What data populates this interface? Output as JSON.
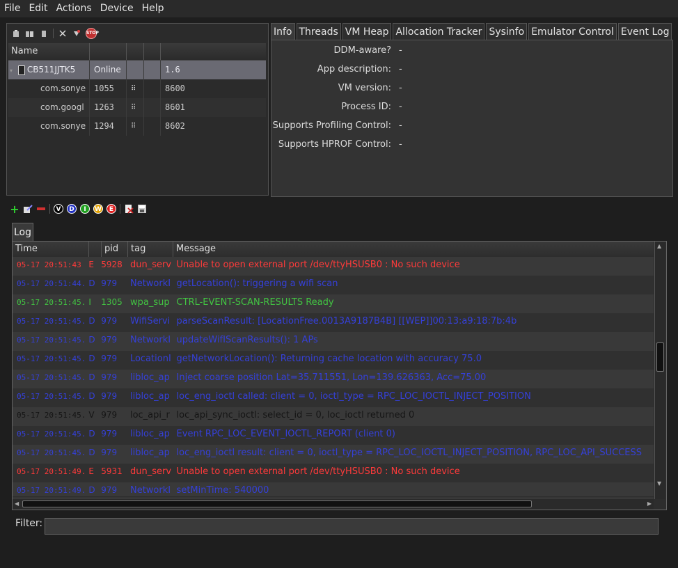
{
  "menu": [
    "File",
    "Edit",
    "Actions",
    "Device",
    "Help"
  ],
  "device_toolbar_icons": [
    "update-heap-icon",
    "update-threads-icon",
    "dump-hprof-icon",
    "cause-gc-icon",
    "start-method-profiling-icon",
    "stop-process-icon"
  ],
  "devices": {
    "columns": [
      "Name",
      "",
      "",
      "",
      ""
    ],
    "rows": [
      {
        "name": "CB511JJTK5",
        "status": "Online",
        "c3": "",
        "c4": "",
        "port": "1.6",
        "selected": true
      },
      {
        "name": "com.sonye",
        "status": "1055",
        "c3": "bug",
        "c4": "",
        "port": "8600"
      },
      {
        "name": "com.googl",
        "status": "1263",
        "c3": "bug",
        "c4": "",
        "port": "8601"
      },
      {
        "name": "com.sonye",
        "status": "1294",
        "c3": "bug",
        "c4": "",
        "port": "8602"
      }
    ]
  },
  "tabs": [
    "Info",
    "Threads",
    "VM Heap",
    "Allocation Tracker",
    "Sysinfo",
    "Emulator Control",
    "Event Log"
  ],
  "active_tab": "Info",
  "info": [
    {
      "label": "DDM-aware?",
      "value": "-"
    },
    {
      "label": "App description:",
      "value": "-"
    },
    {
      "label": "VM version:",
      "value": "-"
    },
    {
      "label": "Process ID:",
      "value": "-"
    },
    {
      "label": "Supports Profiling Control:",
      "value": "-"
    },
    {
      "label": "Supports HPROF Control:",
      "value": "-"
    }
  ],
  "log_toolbar": {
    "buttons": [
      "add-filter-icon",
      "edit-filter-icon",
      "delete-filter-icon"
    ],
    "levels": [
      {
        "letter": "V",
        "color": "#000000"
      },
      {
        "letter": "D",
        "color": "#2030c0"
      },
      {
        "letter": "I",
        "color": "#20a020"
      },
      {
        "letter": "W",
        "color": "#e0a000"
      },
      {
        "letter": "E",
        "color": "#e02020"
      }
    ],
    "extra": [
      "clear-log-icon",
      "save-log-icon"
    ]
  },
  "log_tab": "Log",
  "log_columns": [
    "Time",
    "",
    "pid",
    "tag",
    "Message"
  ],
  "log_rows": [
    {
      "time": "05-17 20:51:43",
      "level": "E",
      "pid": "5928",
      "tag": "dun_serv",
      "msg": "Unable to open external port /dev/ttyHSUSB0 : No such device"
    },
    {
      "time": "05-17 20:51:44.",
      "level": "D",
      "pid": "979",
      "tag": "NetworkI",
      "msg": "getLocation(): triggering a wifi scan"
    },
    {
      "time": "05-17 20:51:45.",
      "level": "I",
      "pid": "1305",
      "tag": "wpa_sup",
      "msg": "CTRL-EVENT-SCAN-RESULTS  Ready"
    },
    {
      "time": "05-17 20:51:45.",
      "level": "D",
      "pid": "979",
      "tag": "WifiServi",
      "msg": "parseScanResult: [LocationFree.0013A9187B4B] [[WEP]]00:13:a9:18:7b:4b"
    },
    {
      "time": "05-17 20:51:45.",
      "level": "D",
      "pid": "979",
      "tag": "NetworkI",
      "msg": "updateWifIScanResults(): 1 APs"
    },
    {
      "time": "05-17 20:51:45.",
      "level": "D",
      "pid": "979",
      "tag": "LocationI",
      "msg": "getNetworkLocation(): Returning cache location with accuracy 75.0"
    },
    {
      "time": "05-17 20:51:45.",
      "level": "D",
      "pid": "979",
      "tag": "libloc_ap",
      "msg": "Inject coarse position Lat=35.711551, Lon=139.626363, Acc=75.00"
    },
    {
      "time": "05-17 20:51:45.",
      "level": "D",
      "pid": "979",
      "tag": "libloc_ap",
      "msg": "loc_eng_ioctl called: client = 0, ioctl_type = RPC_LOC_IOCTL_INJECT_POSITION"
    },
    {
      "time": "05-17 20:51:45.",
      "level": "V",
      "pid": "979",
      "tag": "loc_api_r",
      "msg": "loc_api_sync_ioctl: select_id = 0, loc_ioctl returned 0"
    },
    {
      "time": "05-17 20:51:45.",
      "level": "D",
      "pid": "979",
      "tag": "libloc_ap",
      "msg": "Event RPC_LOC_EVENT_IOCTL_REPORT (client 0)"
    },
    {
      "time": "05-17 20:51:45.",
      "level": "D",
      "pid": "979",
      "tag": "libloc_ap",
      "msg": "loc_eng_ioctl result: client = 0, ioctl_type = RPC_LOC_IOCTL_INJECT_POSITION, RPC_LOC_API_SUCCESS"
    },
    {
      "time": "05-17 20:51:49.",
      "level": "E",
      "pid": "5931",
      "tag": "dun_serv",
      "msg": "Unable to open external port /dev/ttyHSUSB0 : No such device"
    },
    {
      "time": "05-17 20:51:49.",
      "level": "D",
      "pid": "979",
      "tag": "NetworkI",
      "msg": "setMinTime: 540000"
    }
  ],
  "filter": {
    "label": "Filter:",
    "value": "",
    "placeholder": ""
  },
  "colors": {
    "error": "#ff3a3a",
    "debug": "#3540d8",
    "info": "#42c442",
    "verbose": "#151515",
    "selection": "#6a6a73"
  }
}
